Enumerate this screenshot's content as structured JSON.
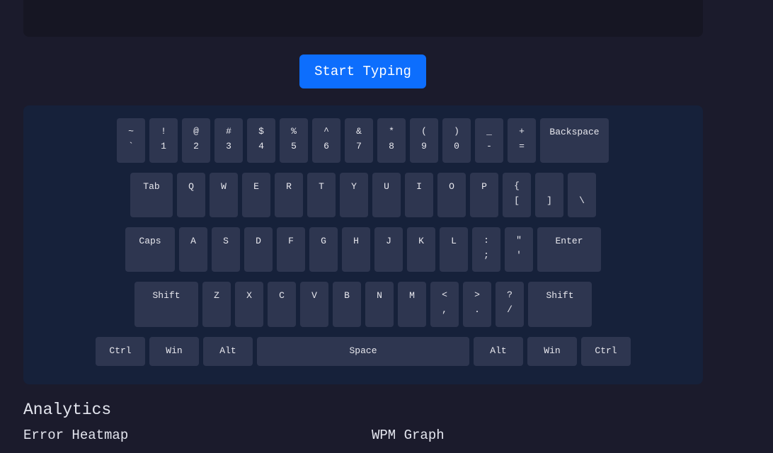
{
  "start_button": {
    "label": "Start Typing"
  },
  "keyboard": {
    "rows": [
      [
        {
          "top": "~",
          "bottom": "`"
        },
        {
          "top": "!",
          "bottom": "1"
        },
        {
          "top": "@",
          "bottom": "2"
        },
        {
          "top": "#",
          "bottom": "3"
        },
        {
          "top": "$",
          "bottom": "4"
        },
        {
          "top": "%",
          "bottom": "5"
        },
        {
          "top": "^",
          "bottom": "6"
        },
        {
          "top": "&",
          "bottom": "7"
        },
        {
          "top": "*",
          "bottom": "8"
        },
        {
          "top": "(",
          "bottom": "9"
        },
        {
          "top": ")",
          "bottom": "0"
        },
        {
          "top": "_",
          "bottom": "-"
        },
        {
          "top": "+",
          "bottom": "="
        },
        {
          "top": "Backspace",
          "bottom": ""
        }
      ],
      [
        {
          "top": "Tab",
          "bottom": ""
        },
        {
          "top": "Q",
          "bottom": ""
        },
        {
          "top": "W",
          "bottom": ""
        },
        {
          "top": "E",
          "bottom": ""
        },
        {
          "top": "R",
          "bottom": ""
        },
        {
          "top": "T",
          "bottom": ""
        },
        {
          "top": "Y",
          "bottom": ""
        },
        {
          "top": "U",
          "bottom": ""
        },
        {
          "top": "I",
          "bottom": ""
        },
        {
          "top": "O",
          "bottom": ""
        },
        {
          "top": "P",
          "bottom": ""
        },
        {
          "top": "{",
          "bottom": "["
        },
        {
          "top": "",
          "bottom": "]"
        },
        {
          "top": "",
          "bottom": "\\"
        }
      ],
      [
        {
          "top": "Caps",
          "bottom": ""
        },
        {
          "top": "A",
          "bottom": ""
        },
        {
          "top": "S",
          "bottom": ""
        },
        {
          "top": "D",
          "bottom": ""
        },
        {
          "top": "F",
          "bottom": ""
        },
        {
          "top": "G",
          "bottom": ""
        },
        {
          "top": "H",
          "bottom": ""
        },
        {
          "top": "J",
          "bottom": ""
        },
        {
          "top": "K",
          "bottom": ""
        },
        {
          "top": "L",
          "bottom": ""
        },
        {
          "top": ":",
          "bottom": ";"
        },
        {
          "top": "\"",
          "bottom": "'"
        },
        {
          "top": "Enter",
          "bottom": ""
        }
      ],
      [
        {
          "top": "Shift",
          "bottom": ""
        },
        {
          "top": "Z",
          "bottom": ""
        },
        {
          "top": "X",
          "bottom": ""
        },
        {
          "top": "C",
          "bottom": ""
        },
        {
          "top": "V",
          "bottom": ""
        },
        {
          "top": "B",
          "bottom": ""
        },
        {
          "top": "N",
          "bottom": ""
        },
        {
          "top": "M",
          "bottom": ""
        },
        {
          "top": "<",
          "bottom": ","
        },
        {
          "top": ">",
          "bottom": "."
        },
        {
          "top": "?",
          "bottom": "/"
        },
        {
          "top": "Shift",
          "bottom": ""
        }
      ],
      [
        {
          "top": "Ctrl",
          "bottom": ""
        },
        {
          "top": "Win",
          "bottom": ""
        },
        {
          "top": "Alt",
          "bottom": ""
        },
        {
          "top": "Space",
          "bottom": ""
        },
        {
          "top": "Alt",
          "bottom": ""
        },
        {
          "top": "Win",
          "bottom": ""
        },
        {
          "top": "Ctrl",
          "bottom": ""
        }
      ]
    ]
  },
  "analytics": {
    "title": "Analytics",
    "error_heatmap_title": "Error Heatmap",
    "wpm_graph_title": "WPM Graph"
  },
  "colors": {
    "background": "#1b1b2c",
    "keyboard_bg": "#16213a",
    "key_bg": "#2e3650",
    "accent": "#0d6efd"
  }
}
